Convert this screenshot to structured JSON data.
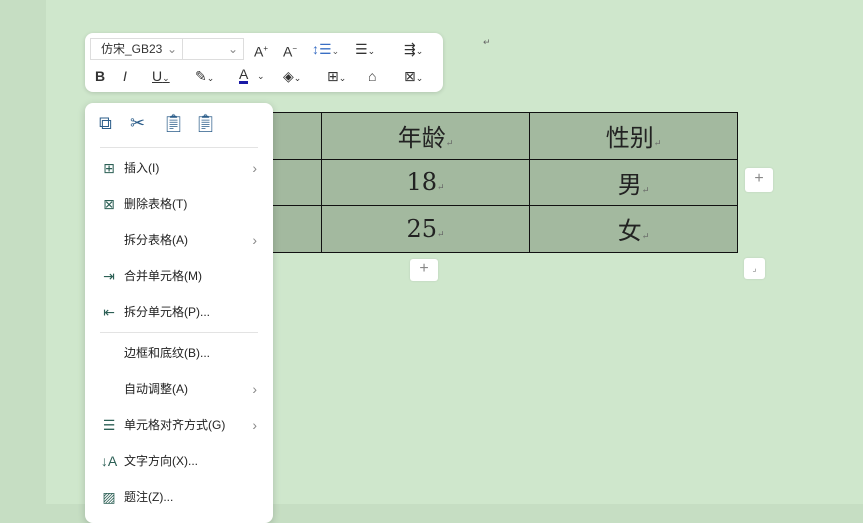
{
  "toolbar": {
    "font_name": "仿宋_GB23",
    "font_size": "",
    "row1": [
      "A+",
      "A−",
      "line-spacing",
      "align"
    ],
    "buttons": [
      "B",
      "I",
      "U",
      "A"
    ]
  },
  "context_menu": {
    "quick_actions": [
      "copy-icon",
      "cut-icon",
      "paste-icon",
      "paste-special-icon"
    ],
    "items": [
      {
        "label": "插入(I)",
        "icon": "⊞",
        "submenu": true
      },
      {
        "label": "删除表格(T)",
        "icon": "⊠",
        "submenu": false
      },
      {
        "label": "拆分表格(A)",
        "icon": "",
        "submenu": true
      },
      {
        "label": "合并单元格(M)",
        "icon": "⇥",
        "submenu": false
      },
      {
        "label": "拆分单元格(P)...",
        "icon": "⇤",
        "submenu": false
      },
      {
        "label": "边框和底纹(B)...",
        "icon": "",
        "submenu": false
      },
      {
        "label": "自动调整(A)",
        "icon": "",
        "submenu": true
      },
      {
        "label": "单元格对齐方式(G)",
        "icon": "☰",
        "submenu": true
      },
      {
        "label": "文字方向(X)...",
        "icon": "↓A",
        "submenu": false
      },
      {
        "label": "题注(Z)...",
        "icon": "▨",
        "submenu": false
      }
    ]
  },
  "table": {
    "rows": [
      [
        "",
        "年龄",
        "性别"
      ],
      [
        "",
        "18",
        "男"
      ],
      [
        "",
        "25",
        "女"
      ]
    ]
  },
  "colors": {
    "page": "#cfe7cc",
    "cell": "#a3b99f",
    "font_color": "#1a1aa6"
  }
}
